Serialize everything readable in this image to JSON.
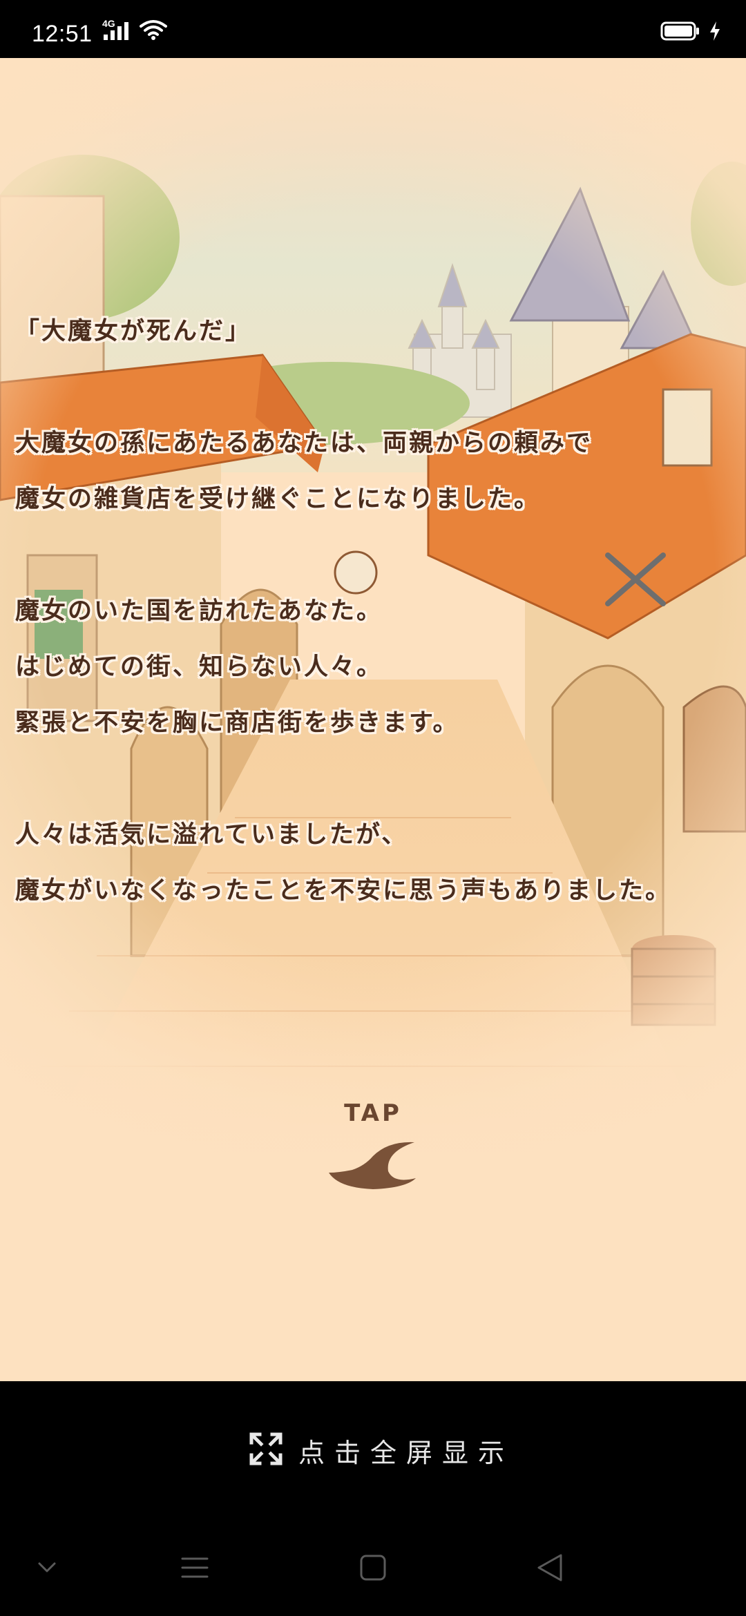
{
  "status_bar": {
    "time": "12:51",
    "network": "4G"
  },
  "story": {
    "lines": [
      "「大魔女が死んだ」",
      "",
      "大魔女の孫にあたるあなたは、両親からの頼みで",
      "魔女の雑貨店を受け継ぐことになりました。",
      "",
      "魔女のいた国を訪れたあなた。",
      "はじめての街、知らない人々。",
      "緊張と不安を胸に商店街を歩きます。",
      "",
      "人々は活気に溢れていましたが、",
      "魔女がいなくなったことを不安に思う声もありました。"
    ]
  },
  "tap": {
    "label": "TAP"
  },
  "fullscreen": {
    "label": "点击全屏显示"
  },
  "colors": {
    "story_text": "#4a2c1c",
    "story_outline": "#fff3e6",
    "background": "#fde1c0",
    "roof": "#e8833a"
  },
  "nav": {
    "icons": [
      "chevron-down-icon",
      "menu-icon",
      "home-icon",
      "back-icon"
    ]
  }
}
